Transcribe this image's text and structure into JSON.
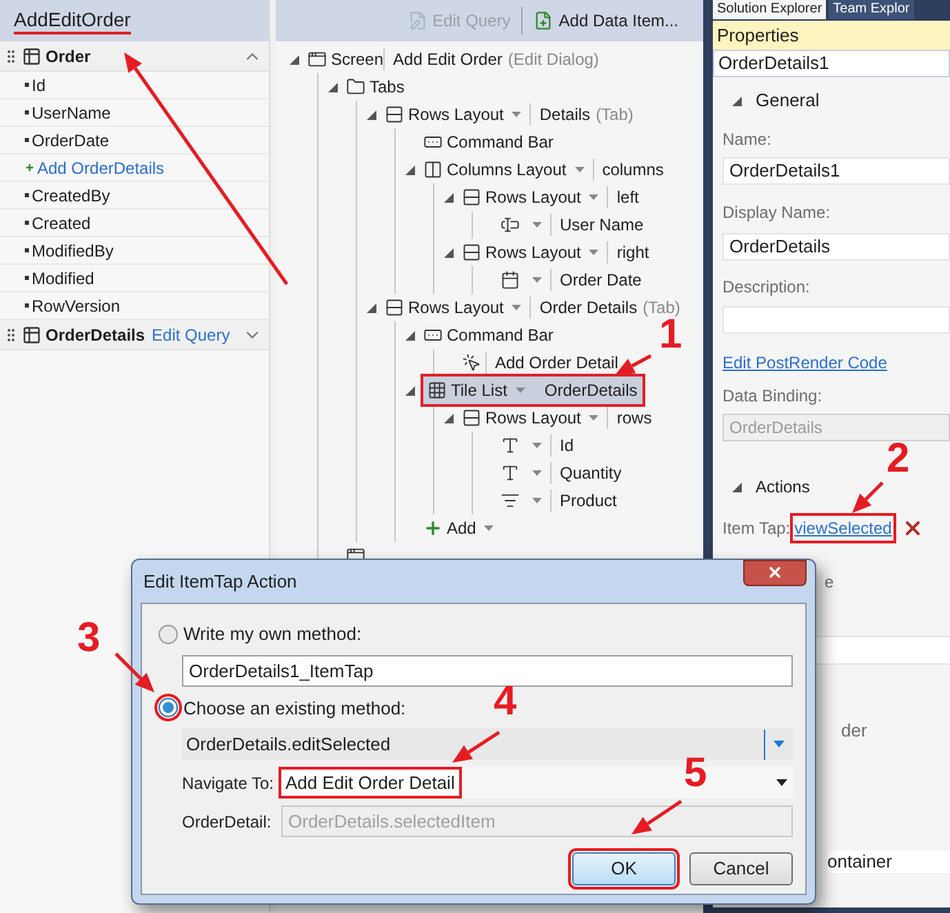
{
  "left_panel": {
    "title": "AddEditOrder",
    "groups": [
      {
        "name": "Order",
        "expanded": true,
        "items": [
          {
            "label": "Id",
            "kind": "field"
          },
          {
            "label": "UserName",
            "kind": "field"
          },
          {
            "label": "OrderDate",
            "kind": "field"
          },
          {
            "label": "Add OrderDetails",
            "kind": "add"
          },
          {
            "label": "CreatedBy",
            "kind": "field"
          },
          {
            "label": "Created",
            "kind": "field"
          },
          {
            "label": "ModifiedBy",
            "kind": "field"
          },
          {
            "label": "Modified",
            "kind": "field"
          },
          {
            "label": "RowVersion",
            "kind": "field"
          }
        ]
      },
      {
        "name": "OrderDetails",
        "expanded": false,
        "link": "Edit Query"
      }
    ]
  },
  "designer": {
    "toolbar": [
      {
        "label": "Edit Query",
        "disabled": true
      },
      {
        "label": "Add Data Item...",
        "disabled": false
      }
    ],
    "tree": [
      {
        "kind": "screen",
        "label": "Screen",
        "value": "Add Edit Order",
        "note": "(Edit Dialog)",
        "expanded": true,
        "selected": false,
        "children": [
          {
            "kind": "tabs",
            "label": "Tabs",
            "expanded": true,
            "selected": false,
            "children": [
              {
                "kind": "rows",
                "label": "Rows Layout",
                "caret": true,
                "value": "Details",
                "note": "(Tab)",
                "expanded": true,
                "selected": false,
                "children": [
                  {
                    "kind": "commandbar",
                    "label": "Command Bar",
                    "selected": false
                  },
                  {
                    "kind": "columns",
                    "label": "Columns Layout",
                    "caret": true,
                    "value": "columns",
                    "expanded": true,
                    "selected": false,
                    "children": [
                      {
                        "kind": "rows",
                        "label": "Rows Layout",
                        "caret": true,
                        "value": "left",
                        "expanded": true,
                        "selected": false,
                        "children": [
                          {
                            "kind": "textbox",
                            "caret": true,
                            "value": "User Name",
                            "selected": false
                          }
                        ]
                      },
                      {
                        "kind": "rows",
                        "label": "Rows Layout",
                        "caret": true,
                        "value": "right",
                        "expanded": true,
                        "selected": false,
                        "children": [
                          {
                            "kind": "datepicker",
                            "caret": true,
                            "value": "Order Date",
                            "selected": false
                          }
                        ]
                      }
                    ]
                  }
                ]
              },
              {
                "kind": "rows",
                "label": "Rows Layout",
                "caret": true,
                "value": "Order Details",
                "note": "(Tab)",
                "expanded": true,
                "selected": false,
                "children": [
                  {
                    "kind": "commandbar",
                    "label": "Command Bar",
                    "expanded": true,
                    "selected": false,
                    "children": [
                      {
                        "kind": "button",
                        "value": "Add Order Detail",
                        "selected": false
                      }
                    ]
                  },
                  {
                    "kind": "tilelist",
                    "label": "Tile List",
                    "caret": true,
                    "value": "OrderDetails",
                    "expanded": true,
                    "selected": true,
                    "children": [
                      {
                        "kind": "rows",
                        "label": "Rows Layout",
                        "caret": true,
                        "value": "rows",
                        "expanded": true,
                        "selected": false,
                        "children": [
                          {
                            "kind": "label",
                            "caret": true,
                            "value": "Id",
                            "selected": false
                          },
                          {
                            "kind": "label",
                            "caret": true,
                            "value": "Quantity",
                            "selected": false
                          },
                          {
                            "kind": "picker",
                            "caret": true,
                            "value": "Product",
                            "selected": false
                          }
                        ]
                      }
                    ]
                  },
                  {
                    "kind": "add",
                    "label": "Add",
                    "caret": true,
                    "selected": false
                  }
                ]
              }
            ]
          },
          {
            "kind": "popups",
            "selected": false
          }
        ]
      }
    ]
  },
  "properties": {
    "tabs": [
      {
        "label": "Solution Explorer",
        "selected": true
      },
      {
        "label": "Team Explor",
        "selected": false
      }
    ],
    "title": "Properties",
    "object": "OrderDetails1",
    "general": {
      "header": "General",
      "expanded": true,
      "name_label": "Name:",
      "name": "OrderDetails1",
      "display_label": "Display Name:",
      "display_name": "OrderDetails",
      "description_label": "Description:",
      "postrender_link": "Edit PostRender Code",
      "binding_label": "Data Binding:",
      "binding": "OrderDetails"
    },
    "actions": {
      "header": "Actions",
      "expanded": true,
      "item_tap_label": "Item Tap:",
      "item_tap": "viewSelected"
    },
    "partial_texts": [
      "e",
      "der",
      "ontainer"
    ]
  },
  "dialog": {
    "title": "Edit ItemTap Action",
    "methods": [
      {
        "label": "Write my own method:",
        "selected": false,
        "value": "OrderDetails1_ItemTap",
        "kind": "text"
      },
      {
        "label": "Choose an existing method:",
        "selected": true,
        "value": "OrderDetails.editSelected",
        "kind": "combo"
      }
    ],
    "params": [
      {
        "label": "Navigate To:",
        "value": "Add Edit Order Detail",
        "disabled": false
      },
      {
        "label": "OrderDetail:",
        "value": "OrderDetails.selectedItem",
        "disabled": true
      }
    ],
    "buttons": [
      {
        "label": "OK",
        "default": true
      },
      {
        "label": "Cancel",
        "default": false
      }
    ]
  },
  "callouts": [
    {
      "label": "1"
    },
    {
      "label": "2"
    },
    {
      "label": "3"
    },
    {
      "label": "4"
    },
    {
      "label": "5"
    }
  ]
}
